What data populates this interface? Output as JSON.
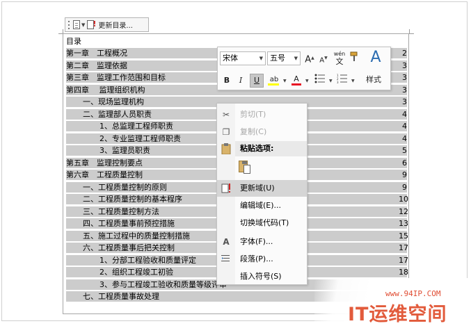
{
  "field_toolbar": {
    "update_label": "更新目录..."
  },
  "toc": {
    "heading": "目录",
    "lines": [
      {
        "text": "第一章　工程概况",
        "page": "2",
        "level": 0,
        "shade": 120
      },
      {
        "text": "第二章　监理依据",
        "page": "3",
        "level": 0,
        "shade": 120
      },
      {
        "text": "第三章　监理工作范围和目标",
        "page": "3",
        "level": 0,
        "shade": 160
      },
      {
        "text": "第四章　 监理组织机构",
        "page": "3",
        "level": 0,
        "shade": 150
      },
      {
        "text": "一、现场监理机构",
        "page": "3",
        "level": 1,
        "shade": 136
      },
      {
        "text": "二、监理部人员职责",
        "page": "4",
        "level": 1,
        "shade": 140
      },
      {
        "text": "1、总监理工程师职责",
        "page": "4",
        "level": 2,
        "shade": 168
      },
      {
        "text": "2、专业监理工程师职责",
        "page": "4",
        "level": 2,
        "shade": 178
      },
      {
        "text": "3、监理员职责",
        "page": "5",
        "level": 2,
        "shade": 128
      },
      {
        "text": "第五章　监理控制要点",
        "page": "6",
        "level": 0,
        "shade": 125
      },
      {
        "text": "第六章　工程质量控制",
        "page": "9",
        "level": 0,
        "shade": 125
      },
      {
        "text": "一、工程质量控制的原则",
        "page": "9",
        "level": 1,
        "shade": 160
      },
      {
        "text": "二、工程质量控制的基本程序",
        "page": "10",
        "level": 1,
        "shade": 190
      },
      {
        "text": "三、工程质量控制方法",
        "page": "12",
        "level": 1,
        "shade": 150
      },
      {
        "text": "四、工程质量事前预控措施",
        "page": "13",
        "level": 1,
        "shade": 175
      },
      {
        "text": "五、施工过程中的质量控制措施",
        "page": "15",
        "level": 1,
        "shade": 200
      },
      {
        "text": "六、工程质量事后把关控制",
        "page": "17",
        "level": 1,
        "shade": 175
      },
      {
        "text": "1、分部工程验收和质量评定",
        "page": "17",
        "level": 2,
        "shade": 235
      },
      {
        "text": "2、组织工程竣工初验",
        "page": "18",
        "level": 2,
        "shade": 200
      },
      {
        "text": "3、参与工程竣工验收和质量等级评审",
        "page": "",
        "level": 2,
        "shade": 240
      },
      {
        "text": "七、工程质量事故处理",
        "page": "",
        "level": 1,
        "shade": 140
      }
    ]
  },
  "mini_toolbar": {
    "font_name": "宋体",
    "font_size": "五号",
    "grow_font": "A",
    "shrink_font": "A",
    "phonetic_top": "wén",
    "phonetic_bottom": "文",
    "bold": "B",
    "italic": "I",
    "underline": "U",
    "highlight": "ab",
    "font_color": "A",
    "styles_label": "样式",
    "highlight_color": "#ffff00",
    "font_color_value": "#e81123"
  },
  "context_menu": {
    "cut": "剪切(T)",
    "copy": "复制(C)",
    "paste_options": "粘贴选项:",
    "update_field": "更新域(U)",
    "edit_field": "编辑域(E)...",
    "toggle_field_codes": "切换域代码(T)",
    "font": "字体(F)...",
    "paragraph": "段落(P)...",
    "insert_symbol": "插入符号(S)"
  },
  "watermark": {
    "url": "www.94IP.COM",
    "name": "IT运维空间"
  }
}
